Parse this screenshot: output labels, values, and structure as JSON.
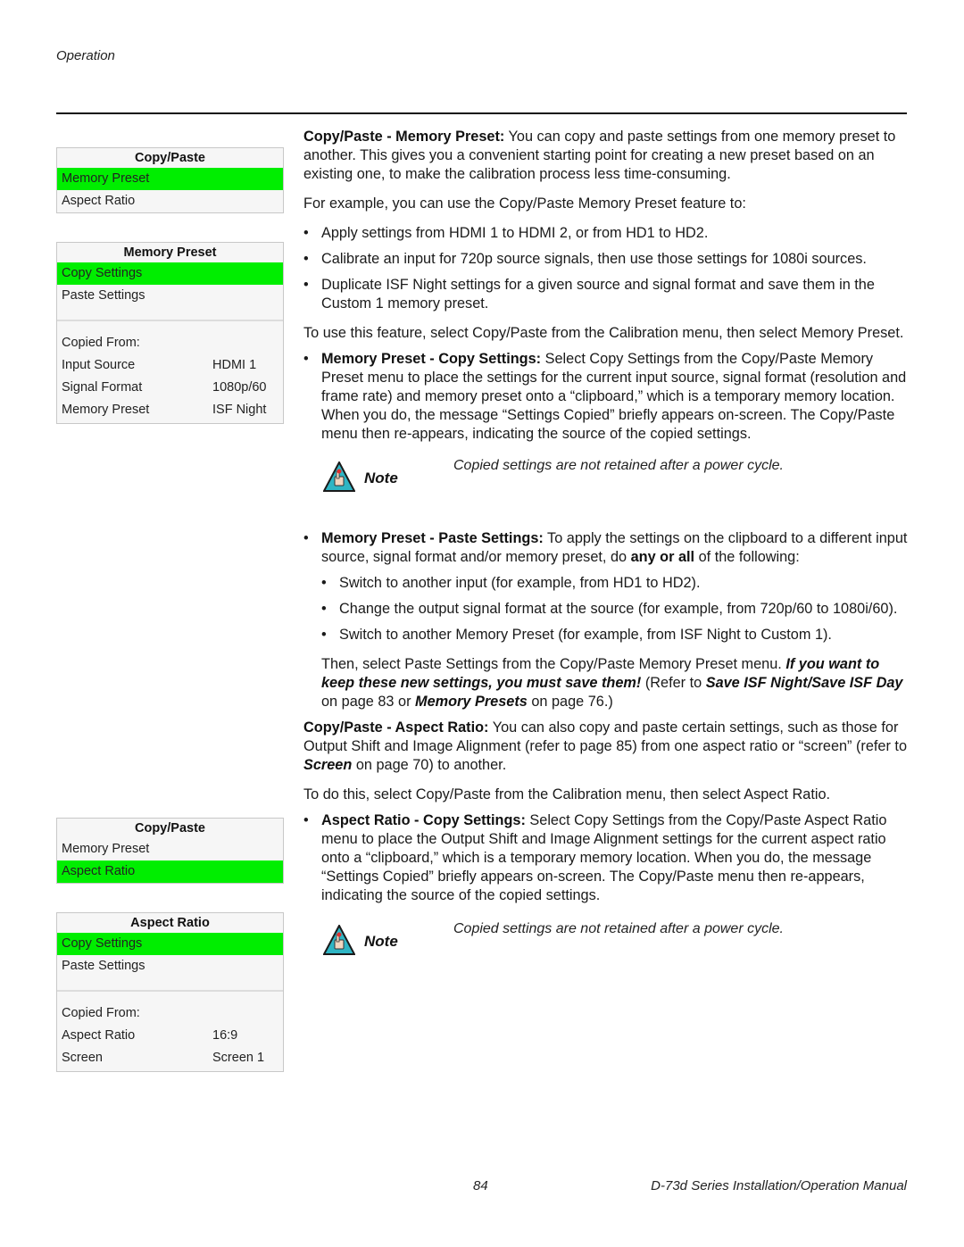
{
  "header": {
    "section": "Operation"
  },
  "menus": {
    "copy_paste_1": {
      "title": "Copy/Paste",
      "items": [
        "Memory Preset",
        "Aspect Ratio"
      ],
      "selected_index": 0
    },
    "memory_preset": {
      "title": "Memory Preset",
      "items": [
        "Copy Settings",
        "Paste Settings"
      ],
      "selected_index": 0,
      "copied_from_label": "Copied From:",
      "rows": [
        {
          "label": "Input Source",
          "value": "HDMI 1"
        },
        {
          "label": "Signal Format",
          "value": "1080p/60"
        },
        {
          "label": "Memory Preset",
          "value": "ISF Night"
        }
      ]
    },
    "copy_paste_2": {
      "title": "Copy/Paste",
      "items": [
        "Memory Preset",
        "Aspect Ratio"
      ],
      "selected_index": 1
    },
    "aspect_ratio": {
      "title": "Aspect Ratio",
      "items": [
        "Copy Settings",
        "Paste Settings"
      ],
      "selected_index": 0,
      "copied_from_label": "Copied From:",
      "rows": [
        {
          "label": "Aspect Ratio",
          "value": "16:9"
        },
        {
          "label": "Screen",
          "value": "Screen 1"
        }
      ]
    },
    "highlight_color": "#00ee00"
  },
  "body": {
    "p1_bold": "Copy/Paste - Memory Preset:",
    "p1_text": " You can copy and paste settings from one memory preset to another. This gives you a convenient starting point for creating a new preset based on an existing one, to make the calibration process less time-consuming.",
    "p2": "For example, you can use the Copy/Paste Memory Preset feature to:",
    "example_bullets": [
      "Apply settings from HDMI 1 to HDMI 2, or from HD1 to HD2.",
      "Calibrate an input for 720p source signals, then use those settings for 1080i sources.",
      "Duplicate ISF Night settings for a given source and signal format and save them in the Custom 1 memory preset."
    ],
    "p3": "To use this feature, select Copy/Paste from the Calibration menu, then select Memory Preset.",
    "mp_copy_bold": "Memory Preset - Copy Settings:",
    "mp_copy_text": " Select Copy Settings from the Copy/Paste Memory Preset menu to place the settings for the current input source, signal format (resolution and frame rate) and memory preset onto a “clipboard,” which is a temporary memory location. When you do, the message “Settings Copied” briefly appears on-screen. The Copy/Paste menu then re-appears, indicating the source of the copied settings.",
    "note_label": "Note",
    "note_text": "Copied settings are not retained after a power cycle.",
    "mp_paste_bold": "Memory Preset - Paste Settings:",
    "mp_paste_text_a": " To apply the settings on the clipboard to a different input source, signal format and/or memory preset, do ",
    "mp_paste_bold2": "any or all",
    "mp_paste_text_b": " of the following:",
    "paste_bullets": [
      "Switch to another input (for example, from HD1 to HD2).",
      "Change the output signal format at the source (for example, from 720p/60 to 1080i/60).",
      "Switch to another Memory Preset (for example, from ISF Night to Custom 1)."
    ],
    "then_text_a": "Then, select Paste Settings from the Copy/Paste Memory Preset menu. ",
    "then_bi": "If you want to keep these new settings, you must save them!",
    "then_text_b": " (Refer to ",
    "then_ref1": "Save ISF Night/Save ISF Day",
    "then_text_c": " on page 83 or ",
    "then_ref2": "Memory Presets",
    "then_text_d": " on page 76.)",
    "ar_bold": "Copy/Paste - Aspect Ratio:",
    "ar_text_a": " You can also copy and paste certain settings, such as those for Output Shift and Image Alignment (refer to page 85) from one aspect ratio or “screen” (refer to ",
    "ar_ref": "Screen",
    "ar_text_b": " on page 70) to another.",
    "p_todo": "To do this, select Copy/Paste from the Calibration menu, then select Aspect Ratio.",
    "ar_copy_bold": "Aspect Ratio - Copy Settings:",
    "ar_copy_text": " Select Copy Settings from the Copy/Paste Aspect Ratio menu to place the Output Shift and Image Alignment settings for the current aspect ratio onto a “clipboard,” which is a temporary memory location. When you do, the message “Settings Copied” briefly appears on-screen. The Copy/Paste menu then re-appears, indicating the source of the copied settings."
  },
  "footer": {
    "page_number": "84",
    "manual_title": "D-73d Series Installation/Operation Manual"
  }
}
